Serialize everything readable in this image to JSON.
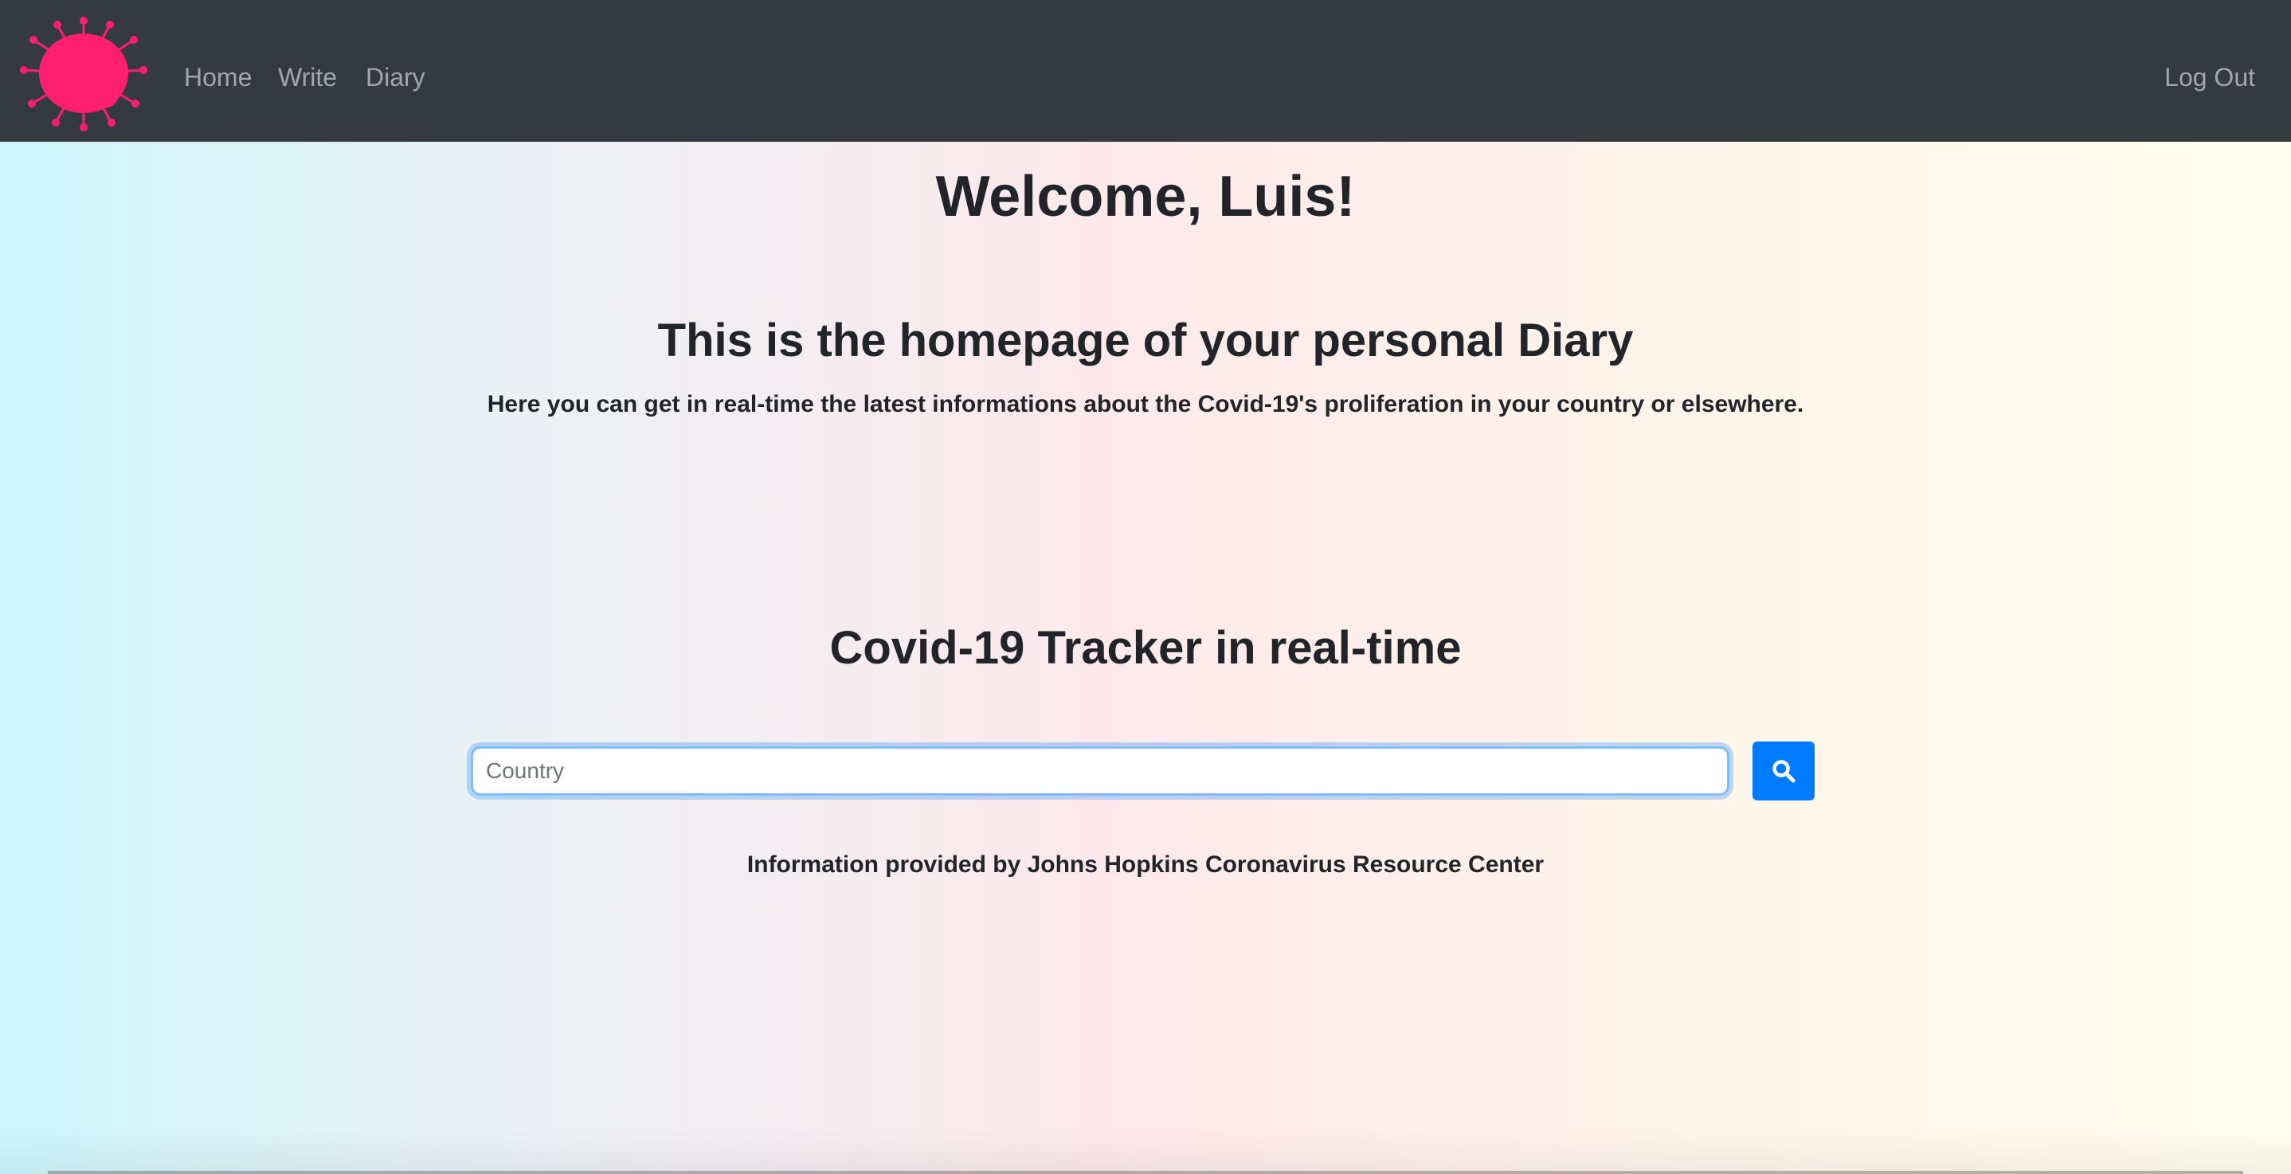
{
  "navbar": {
    "logo_icon": "virus-icon",
    "logo_color": "#ff1f6e",
    "background": "#343a40",
    "items": [
      {
        "label": "Home"
      },
      {
        "label": "Write"
      },
      {
        "label": "Diary"
      }
    ],
    "logout_label": "Log Out"
  },
  "main": {
    "welcome": "Welcome, Luis!",
    "subtitle": "This is the homepage of your personal Diary",
    "lead": "Here you can get in real-time the latest informations about the Covid-19's proliferation in your country or elsewhere.",
    "tracker_title": "Covid-19 Tracker in real-time",
    "search": {
      "placeholder": "Country",
      "value": "",
      "button_icon": "search-icon",
      "button_color": "#007bff"
    },
    "credit": "Information provided by Johns Hopkins Coronavirus Resource Center"
  }
}
